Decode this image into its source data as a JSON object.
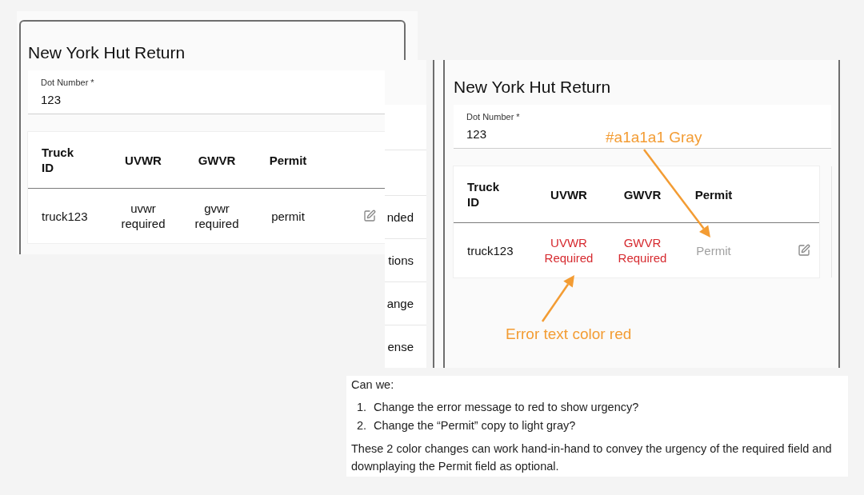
{
  "before_screen": {
    "title": "New York Hut Return",
    "field": {
      "label": "Dot Number *",
      "value": "123"
    },
    "table": {
      "columns": [
        "Truck ID",
        "UVWR",
        "GWVR",
        "Permit"
      ],
      "rows": [
        {
          "cells": [
            {
              "text": "truck123",
              "kind": "plain"
            },
            {
              "text": "uvwr required",
              "kind": "plain"
            },
            {
              "text": "gvwr required",
              "kind": "plain"
            },
            {
              "text": "permit",
              "kind": "plain"
            }
          ]
        }
      ]
    }
  },
  "hidden_list": {
    "items": [
      "nded",
      "tions",
      "ange",
      "ense"
    ]
  },
  "after_screen": {
    "title": "New York Hut Return",
    "field": {
      "label": "Dot Number *",
      "value": "123"
    },
    "table": {
      "columns": [
        "Truck ID",
        "UVWR",
        "GWVR",
        "Permit"
      ],
      "rows": [
        {
          "cells": [
            {
              "text": "truck123",
              "kind": "plain"
            },
            {
              "text": "UVWR Required",
              "kind": "error"
            },
            {
              "text": "GWVR Required",
              "kind": "error"
            },
            {
              "text": "Permit",
              "kind": "optional"
            }
          ]
        }
      ]
    },
    "annotations": [
      {
        "text": "#a1a1a1 Gray"
      },
      {
        "text": "Error text color red"
      }
    ]
  },
  "note": {
    "intro": "Can we:",
    "items": [
      {
        "number": "1.",
        "text": "Change the error message to red to show urgency?"
      },
      {
        "number": "2.",
        "text": "Change the “Permit” copy to light gray?"
      }
    ],
    "paragraph": "These 2 color changes can work hand-in-hand to convey the urgency of the required field and downplaying the Permit field as optional."
  }
}
